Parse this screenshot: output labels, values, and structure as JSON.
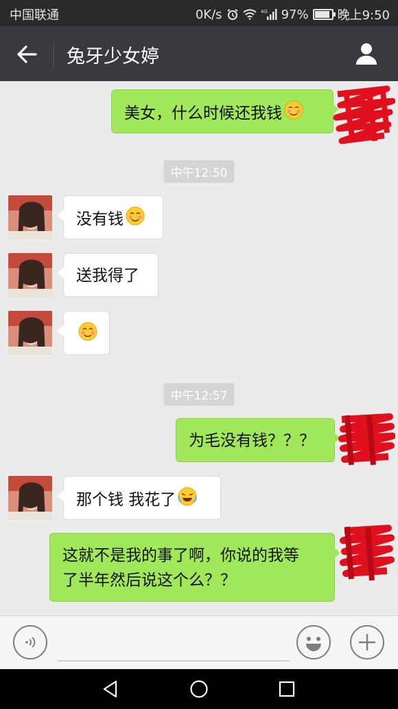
{
  "status_bar": {
    "carrier": "中国联通",
    "network_speed": "0K/s",
    "network_type": "4G",
    "battery": "97%",
    "battery_level": 0.97,
    "time": "晚上9:50"
  },
  "title_bar": {
    "title": "兔牙少女婷",
    "back_icon": "arrow-left-icon",
    "profile_icon": "person-icon"
  },
  "messages": [
    {
      "id": "m1",
      "sender": "me",
      "text": "美女，什么时候还我钱",
      "emoji": "blush-smile-emoji"
    },
    {
      "id": "t1",
      "type": "timestamp",
      "text": "中午12:50"
    },
    {
      "id": "m2",
      "sender": "contact",
      "text": "没有钱",
      "emoji": "blush-smile-emoji"
    },
    {
      "id": "m3",
      "sender": "contact",
      "text": "送我得了"
    },
    {
      "id": "m4",
      "sender": "contact",
      "text": "",
      "emoji": "blush-smile-emoji"
    },
    {
      "id": "t2",
      "type": "timestamp",
      "text": "中午12:57"
    },
    {
      "id": "m5",
      "sender": "me",
      "text": "为毛没有钱？？？"
    },
    {
      "id": "m6",
      "sender": "contact",
      "text": "那个钱 我花了",
      "emoji": "tears-of-joy-emoji"
    },
    {
      "id": "m7",
      "sender": "me",
      "text_line1": "这就不是我的事了啊，你说的我等",
      "text_line2": "了半年然后说这个么？？"
    }
  ],
  "input_bar": {
    "voice_icon": "voice-icon",
    "text_value": "",
    "emoji_icon": "smiley-icon",
    "plus_icon": "plus-icon"
  },
  "nav_bar": {
    "back_icon": "triangle-back-icon",
    "home_icon": "circle-home-icon",
    "recents_icon": "square-recents-icon"
  },
  "colors": {
    "status_bar_bg": "#2a2a2a",
    "title_bar_bg": "#393a3f",
    "chat_bg": "#ebebeb",
    "outgoing_bubble": "#a0e75a",
    "incoming_bubble": "#ffffff",
    "redaction_red": "#e0101e"
  }
}
